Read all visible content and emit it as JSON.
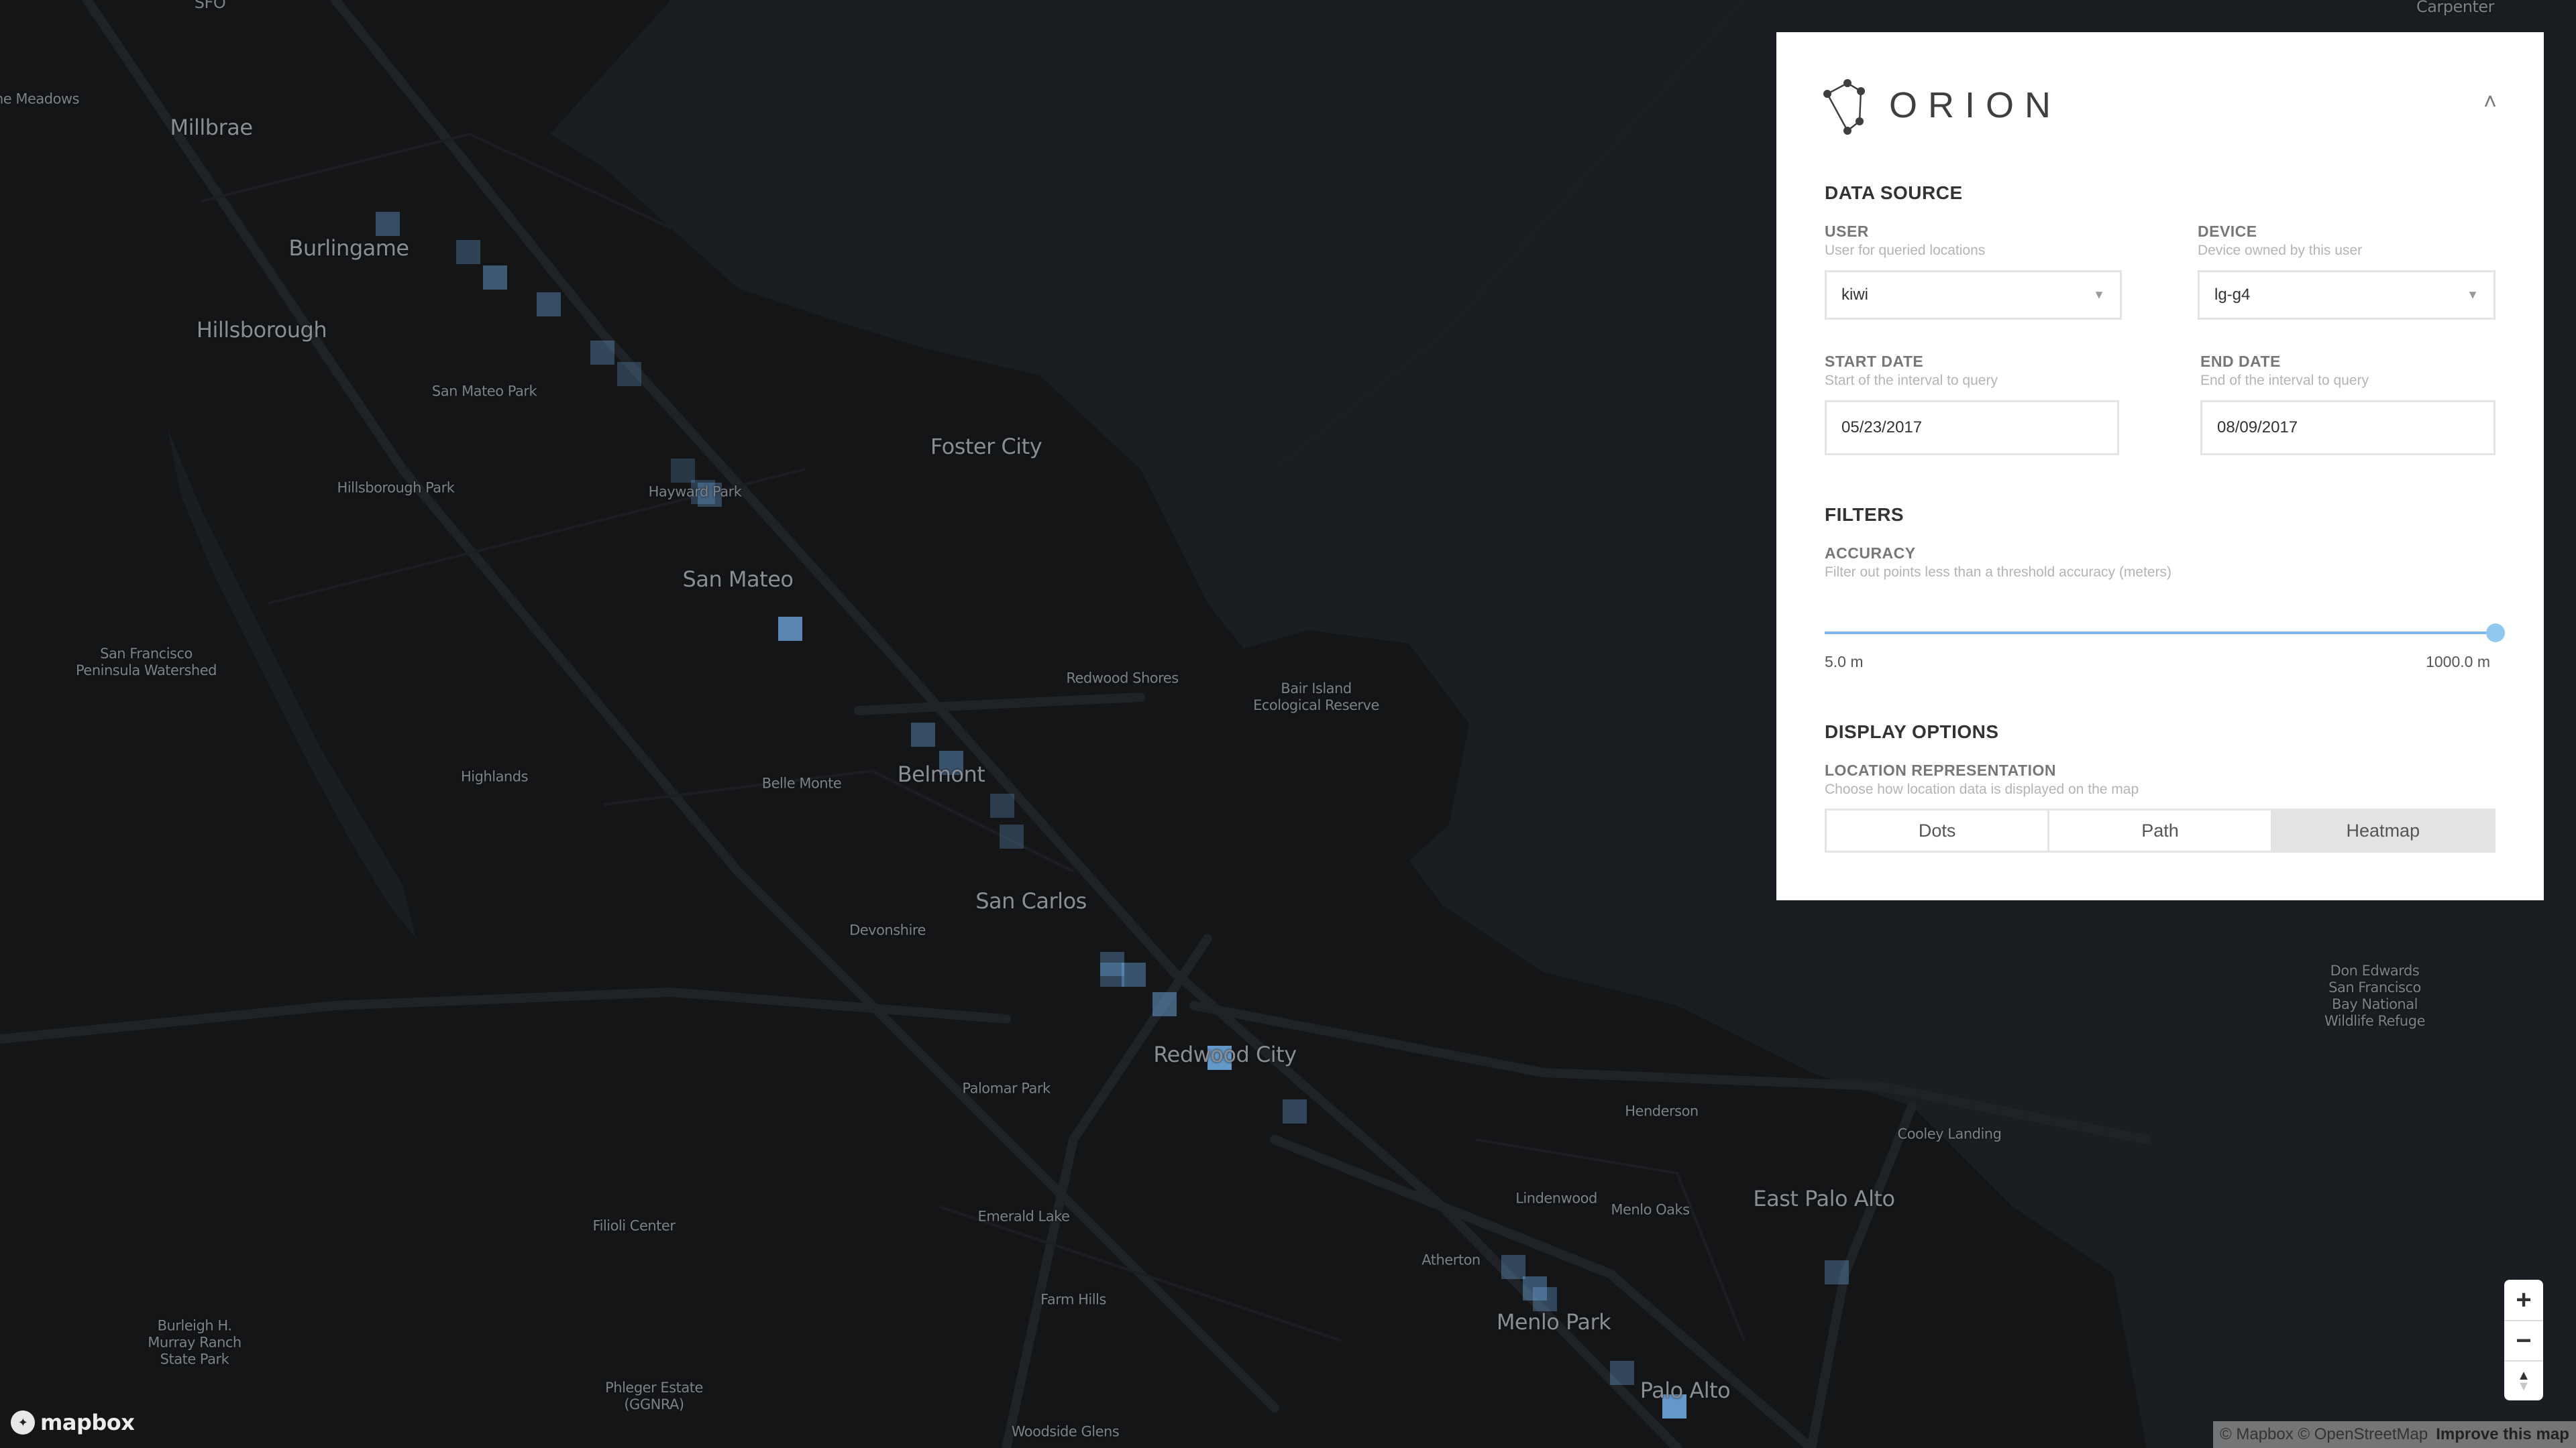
{
  "app": {
    "brand": "ORION",
    "collapse_icon": "chevron-up-icon"
  },
  "data_source": {
    "title": "DATA SOURCE",
    "user": {
      "label": "USER",
      "help": "User for queried locations",
      "value": "kiwi"
    },
    "device": {
      "label": "DEVICE",
      "help": "Device owned by this user",
      "value": "lg-g4"
    },
    "start_date": {
      "label": "START DATE",
      "help": "Start of the interval to query",
      "value": "05/23/2017"
    },
    "end_date": {
      "label": "END DATE",
      "help": "End of the interval to query",
      "value": "08/09/2017"
    }
  },
  "filters": {
    "title": "FILTERS",
    "accuracy": {
      "label": "ACCURACY",
      "help": "Filter out points less than a threshold accuracy (meters)",
      "min_label": "5.0 m",
      "max_label": "1000.0 m",
      "min": 5.0,
      "max": 1000.0,
      "value": 1000.0,
      "accent": "#90c8f0"
    }
  },
  "display_options": {
    "title": "DISPLAY OPTIONS",
    "location_representation": {
      "label": "LOCATION REPRESENTATION",
      "help": "Choose how location data is displayed on the map",
      "options": [
        "Dots",
        "Path",
        "Heatmap"
      ],
      "selected": "Heatmap"
    }
  },
  "map": {
    "labels": [
      {
        "text": "SFO",
        "kind": "town"
      },
      {
        "text": "Carpenter",
        "kind": "town"
      },
      {
        "text": "he Meadows",
        "kind": "poi"
      },
      {
        "text": "Millbrae",
        "kind": "city"
      },
      {
        "text": "Burlingame",
        "kind": "city"
      },
      {
        "text": "Hillsborough",
        "kind": "city"
      },
      {
        "text": "San Mateo Park",
        "kind": "poi"
      },
      {
        "text": "Hillsborough Park",
        "kind": "poi"
      },
      {
        "text": "Hayward Park",
        "kind": "poi"
      },
      {
        "text": "Foster City",
        "kind": "city"
      },
      {
        "text": "San Mateo",
        "kind": "city"
      },
      {
        "text": "San Francisco\nPeninsula Watershed",
        "kind": "poi"
      },
      {
        "text": "Redwood Shores",
        "kind": "poi"
      },
      {
        "text": "Bair Island\nEcological Reserve",
        "kind": "poi"
      },
      {
        "text": "Highlands",
        "kind": "poi"
      },
      {
        "text": "Belle Monte",
        "kind": "poi"
      },
      {
        "text": "Belmont",
        "kind": "city"
      },
      {
        "text": "San Carlos",
        "kind": "city"
      },
      {
        "text": "Devonshire",
        "kind": "poi"
      },
      {
        "text": "Redwood City",
        "kind": "city"
      },
      {
        "text": "Palomar Park",
        "kind": "poi"
      },
      {
        "text": "Emerald Lake",
        "kind": "poi"
      },
      {
        "text": "Farm Hills",
        "kind": "poi"
      },
      {
        "text": "Filioli Center",
        "kind": "poi"
      },
      {
        "text": "Burleigh H.\nMurray Ranch\nState Park",
        "kind": "poi"
      },
      {
        "text": "Phleger Estate\n(GGNRA)",
        "kind": "poi"
      },
      {
        "text": "Woodside Glens",
        "kind": "poi"
      },
      {
        "text": "Henderson",
        "kind": "poi"
      },
      {
        "text": "Cooley Landing",
        "kind": "poi"
      },
      {
        "text": "Don Edwards\nSan Francisco\nBay National\nWildlife Refuge",
        "kind": "poi"
      },
      {
        "text": "East Palo Alto",
        "kind": "city"
      },
      {
        "text": "Lindenwood",
        "kind": "poi"
      },
      {
        "text": "Menlo Oaks",
        "kind": "poi"
      },
      {
        "text": "Atherton",
        "kind": "poi"
      },
      {
        "text": "Menlo Park",
        "kind": "city"
      },
      {
        "text": "Palo Alto",
        "kind": "city"
      }
    ],
    "heatmap_intensity": [
      0.35,
      0.25,
      0.45,
      0.35,
      0.3,
      0.2,
      0.15,
      0.2,
      0.3,
      0.85,
      0.35,
      0.4,
      0.2,
      0.2,
      0.3,
      0.4,
      0.5,
      1.0,
      0.3,
      0.3,
      0.3,
      0.4,
      0.3,
      0.3,
      1.0,
      0.3
    ],
    "heatmap_color": "#6ea6dc",
    "controls": {
      "zoom_in": "+",
      "zoom_out": "−",
      "compass_icon": "compass-icon"
    },
    "attribution": {
      "text": "© Mapbox © OpenStreetMap",
      "improve": "Improve this map"
    },
    "logo_text": "mapbox"
  }
}
